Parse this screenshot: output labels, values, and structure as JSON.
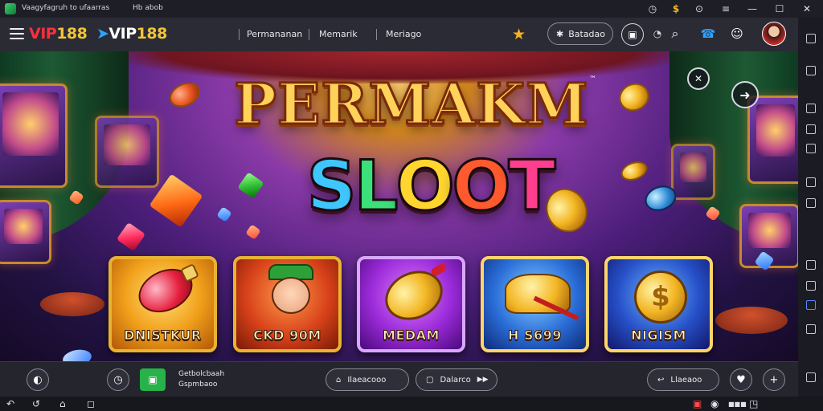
{
  "titlebar": {
    "app_title": "Vaagyfagruh to ufaarras",
    "subtitle": "Hb abob",
    "controls": {
      "timer": "◷",
      "coin": "$",
      "settings": "⊙",
      "menu": "≡",
      "minimize": "—",
      "maximize": "☐",
      "close": "✕"
    }
  },
  "header": {
    "logo1": {
      "v": "VIP",
      "n": "188"
    },
    "logo2": {
      "arrow": "➤",
      "v": "VIP",
      "n": "188"
    },
    "nav": [
      "Permananan",
      "Memarik",
      "Meriago"
    ],
    "star": "★",
    "action_button": {
      "icon": "✱",
      "label": "Batadao"
    },
    "icons": [
      "▣",
      "◔",
      "⌕",
      "☎",
      "☺"
    ],
    "colors": {
      "red": "#ff2e3e",
      "gold": "#f3c436",
      "blue": "#2ea2ff"
    }
  },
  "hero": {
    "title_line1": "PERMAKM",
    "trademark": "™",
    "title_line2": [
      "S",
      "L",
      "O",
      "O",
      "T"
    ],
    "title_line2_colors": [
      "#3ec7ff",
      "#3be07a",
      "#ffd52e",
      "#ff5a2e",
      "#ff3e8e"
    ],
    "close_icon": "✕",
    "next_icon": "➜",
    "cards": [
      {
        "label": "DNISTKUR",
        "art": "potion"
      },
      {
        "label": "CKD 90M",
        "art": "character"
      },
      {
        "label": "MEDAM",
        "art": "coin"
      },
      {
        "label": "H S699",
        "art": "treasure"
      },
      {
        "label": "NIGISM",
        "art": "dollar"
      }
    ],
    "card_glyphs": {
      "potion": "",
      "character": "☻",
      "coin": "",
      "treasure": "",
      "dollar": "$"
    }
  },
  "bottombar": {
    "left_icons": [
      "◐",
      "◷"
    ],
    "media_lines": [
      "Getbolcbaah",
      "Gspmbaoo"
    ],
    "pill1": {
      "icon": "⌂",
      "label": "Ilaeacooo"
    },
    "pill2": {
      "icon": "▢",
      "label": "Dalarco",
      "extra": "▶▶"
    },
    "pill3": {
      "icon": "↩",
      "label": "Llaeaoo"
    },
    "right_icons": [
      "♥",
      "+"
    ]
  },
  "navbar": {
    "left": [
      "↶",
      "↺",
      "⌂",
      "◻"
    ],
    "right": [
      "▣",
      "◉",
      "■■■",
      "◳"
    ]
  }
}
